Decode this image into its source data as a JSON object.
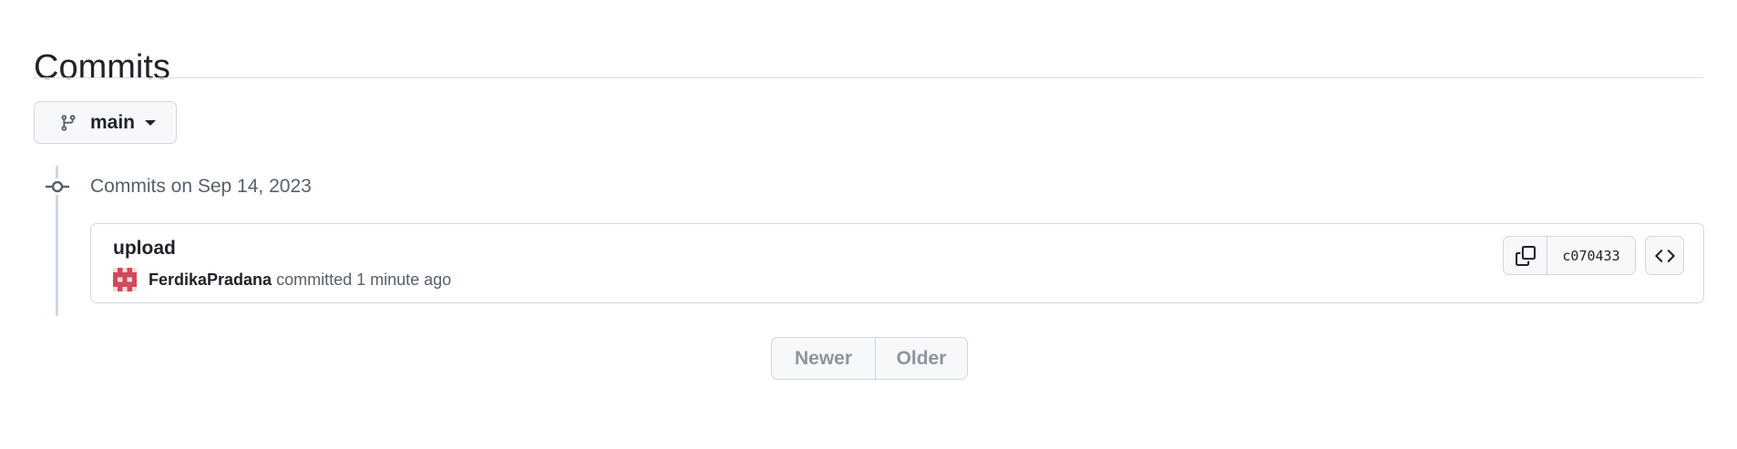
{
  "page": {
    "title": "Commits"
  },
  "branch_selector": {
    "label": "main",
    "icon": "git-branch-icon"
  },
  "commit_groups": [
    {
      "heading": "Commits on Sep 14, 2023",
      "commits": [
        {
          "message": "upload",
          "author": "FerdikaPradana",
          "action": "committed",
          "time": "1 minute ago",
          "sha": "c070433"
        }
      ]
    }
  ],
  "pagination": {
    "newer_label": "Newer",
    "older_label": "Older"
  },
  "colors": {
    "border": "#d0d7de",
    "button_bg": "#f6f8fa",
    "muted_text": "#57606a",
    "disabled_text": "#8c959f",
    "avatar": "#cf4b58"
  }
}
